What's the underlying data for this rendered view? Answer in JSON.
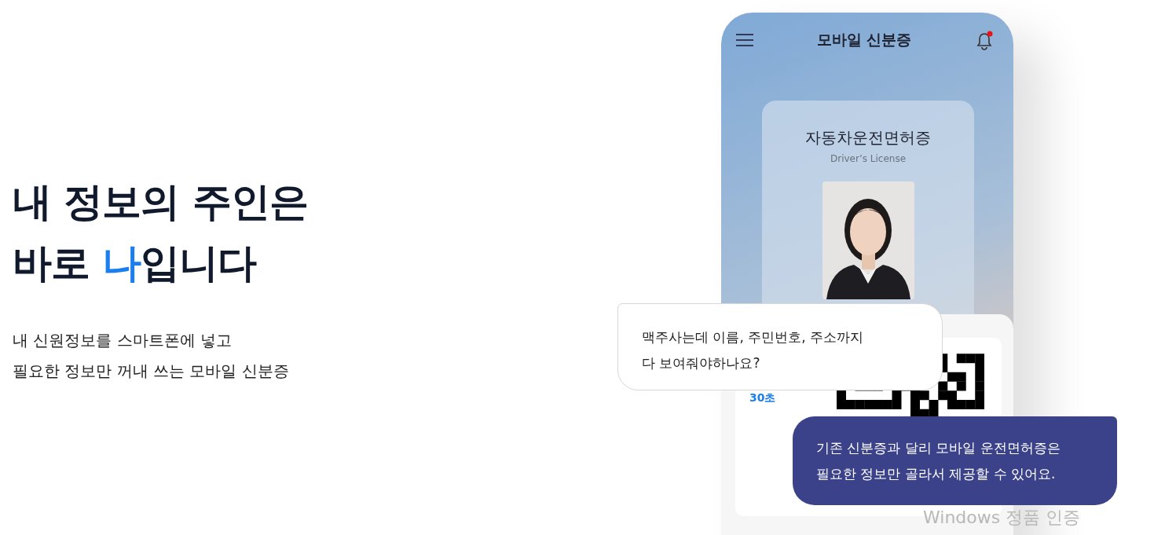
{
  "hero": {
    "headline_line_1": "내 정보의 주인은",
    "headline_line_2": {
      "before": "바로 ",
      "highlight": "나",
      "after": "입니다"
    },
    "description": [
      "내 신원정보를 스마트폰에 넣고",
      "필요한 정보만 꺼내 쓰는 모바일 신분증"
    ]
  },
  "phone": {
    "title": "모바일 신분증",
    "notification_unread": true,
    "card": {
      "title": "자동차운전면허증",
      "subtitle": "Driver’s License"
    },
    "timer": "30초"
  },
  "bubbles": [
    {
      "kind": "question",
      "lines": [
        "맥주사는데 이름, 주민번호, 주소까지",
        "다 보여줘야하나요?"
      ]
    },
    {
      "kind": "answer",
      "lines": [
        "기존 신분증과 달리 모바일 운전면허증은",
        "필요한 정보만 골라서 제공할 수 있어요."
      ]
    }
  ],
  "system_notice": "Windows 정품 인증"
}
